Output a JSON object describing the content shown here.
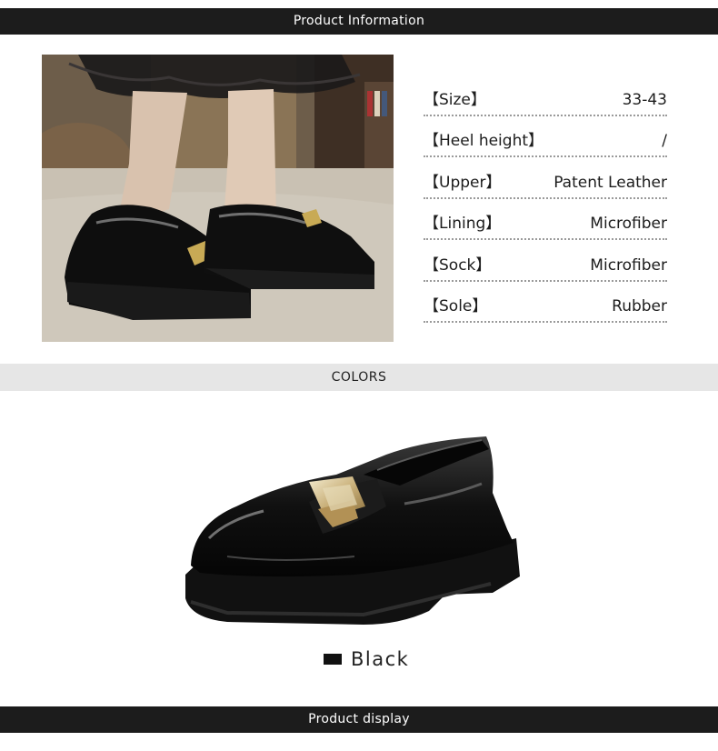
{
  "header": {
    "title": "Product Information"
  },
  "specs": [
    {
      "key": "【Size】",
      "value": "33-43"
    },
    {
      "key": "【Heel height】",
      "value": "/"
    },
    {
      "key": "【Upper】",
      "value": "Patent Leather"
    },
    {
      "key": "【Lining】",
      "value": "Microfiber"
    },
    {
      "key": "【Sock】",
      "value": "Microfiber"
    },
    {
      "key": "【Sole】",
      "value": "Rubber"
    }
  ],
  "colors_section": {
    "title": "COLORS"
  },
  "color_option": {
    "name": "Black",
    "swatch_color": "#111111"
  },
  "footer": {
    "title": "Product display"
  }
}
